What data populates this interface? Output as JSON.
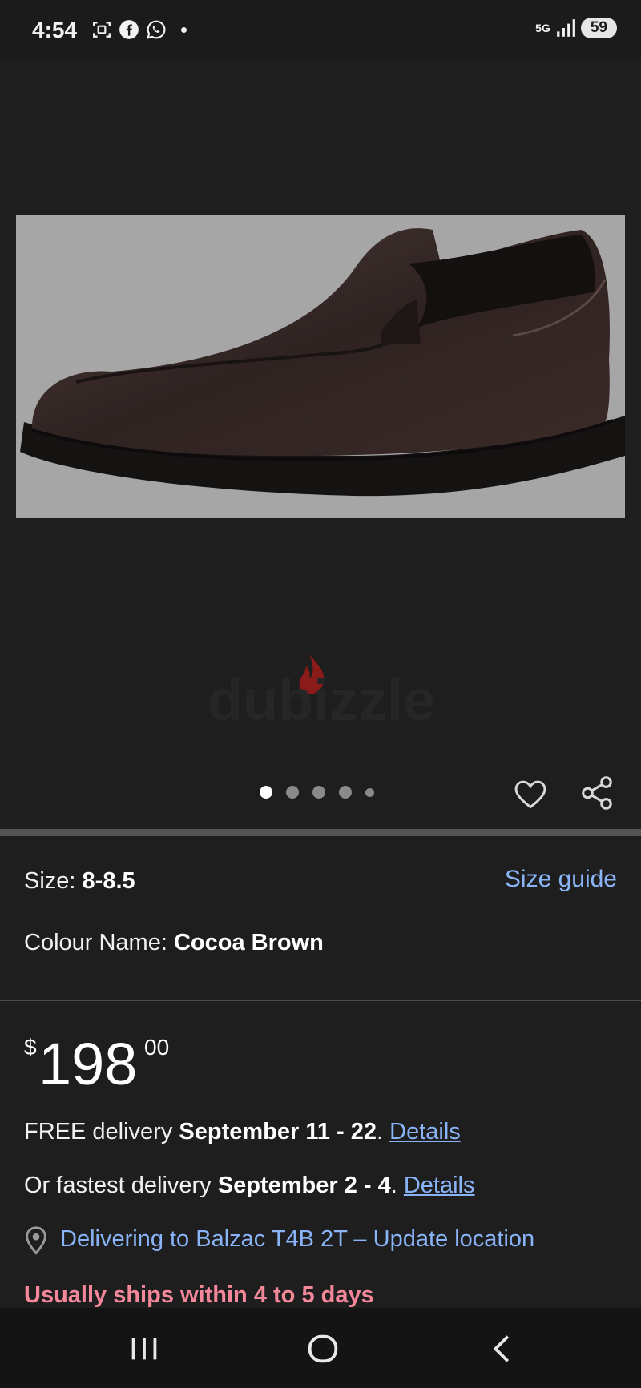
{
  "status_bar": {
    "time": "4:54",
    "network": "5G",
    "battery": "59",
    "icons": [
      "screenshot-icon",
      "facebook-icon",
      "whatsapp-icon",
      "notification-dot",
      "signal-icon"
    ]
  },
  "gallery": {
    "product_image": "leather-slip-on-loafer",
    "watermark": "dubizzle",
    "page_count": 5,
    "active_page": 1
  },
  "details": {
    "size_label": "Size: ",
    "size_value": "8-8.5",
    "size_guide": "Size guide",
    "colour_label": "Colour Name: ",
    "colour_value": "Cocoa Brown"
  },
  "price": {
    "currency": "$",
    "whole": "198",
    "fraction": "00"
  },
  "delivery": {
    "free_prefix": "FREE delivery ",
    "free_dates": "September 11 - 22",
    "free_suffix": ". ",
    "free_link": "Details",
    "fast_prefix": "Or fastest delivery ",
    "fast_dates": "September 2 - 4",
    "fast_suffix": ". ",
    "fast_link": "Details",
    "location": "Delivering to Balzac T4B 2T – Update location",
    "ships": "Usually ships within 4 to 5 days"
  },
  "colors": {
    "link": "#8ab4f8",
    "ships": "#f4889a",
    "background": "#1e1e1f"
  }
}
